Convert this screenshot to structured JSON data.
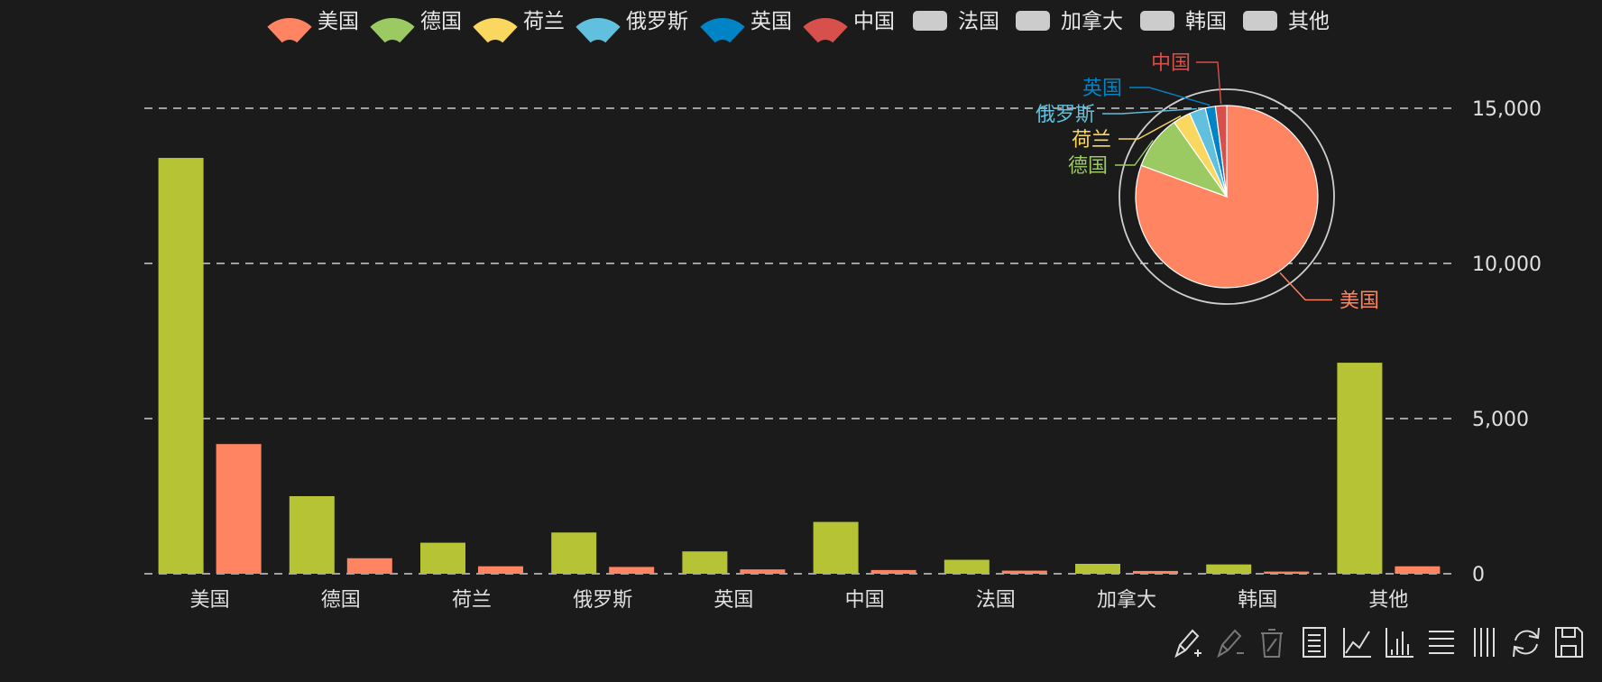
{
  "chart_data": [
    {
      "type": "bar",
      "categories": [
        "美国",
        "德国",
        "荷兰",
        "俄罗斯",
        "英国",
        "中国",
        "法国",
        "加拿大",
        "韩国",
        "其他"
      ],
      "series": [
        {
          "color": "#b5c334",
          "values": [
            13400,
            2500,
            1000,
            1330,
            720,
            1670,
            450,
            320,
            300,
            6800
          ]
        },
        {
          "color": "#ff8462",
          "values": [
            4180,
            500,
            240,
            220,
            140,
            120,
            100,
            90,
            70,
            240
          ]
        }
      ],
      "ylim": [
        0,
        15000
      ],
      "yticks": [
        "0",
        "5,000",
        "10,000",
        "15,000"
      ],
      "ytick_values": [
        0,
        5000,
        10000,
        15000
      ],
      "grid": true,
      "y_axis_position": "right"
    },
    {
      "type": "pie",
      "legend": [
        {
          "label": "美国",
          "color": "#ff8462",
          "active": true
        },
        {
          "label": "德国",
          "color": "#9bca63",
          "active": true
        },
        {
          "label": "荷兰",
          "color": "#fad860",
          "active": true
        },
        {
          "label": "俄罗斯",
          "color": "#60c0dd",
          "active": true
        },
        {
          "label": "英国",
          "color": "#0084c6",
          "active": true
        },
        {
          "label": "中国",
          "color": "#d7504b",
          "active": true
        },
        {
          "label": "法国",
          "color": "#cccccc",
          "active": false
        },
        {
          "label": "加拿大",
          "color": "#cccccc",
          "active": false
        },
        {
          "label": "韩国",
          "color": "#cccccc",
          "active": false
        },
        {
          "label": "其他",
          "color": "#cccccc",
          "active": false
        }
      ],
      "slices": [
        {
          "label": "美国",
          "value": 13400,
          "color": "#ff8462"
        },
        {
          "label": "德国",
          "value": 1600,
          "color": "#9bca63"
        },
        {
          "label": "荷兰",
          "value": 520,
          "color": "#fad860"
        },
        {
          "label": "俄罗斯",
          "value": 480,
          "color": "#60c0dd"
        },
        {
          "label": "英国",
          "value": 300,
          "color": "#0084c6"
        },
        {
          "label": "中国",
          "value": 330,
          "color": "#d7504b"
        }
      ],
      "legend_position": "top"
    }
  ],
  "toolbox": [
    {
      "name": "mark-icon"
    },
    {
      "name": "mark-undo-icon",
      "disabled": true
    },
    {
      "name": "mark-clear-icon",
      "disabled": true
    },
    {
      "name": "data-view-icon"
    },
    {
      "name": "line-chart-icon"
    },
    {
      "name": "bar-chart-icon"
    },
    {
      "name": "stack-icon"
    },
    {
      "name": "tiled-icon"
    },
    {
      "name": "restore-icon"
    },
    {
      "name": "save-image-icon"
    }
  ],
  "colors": {
    "background": "#1b1b1b",
    "text": "#e0e0e0",
    "grid": "#cccccc",
    "toolbox": "#dddddd",
    "toolbox_disabled": "#777777"
  }
}
